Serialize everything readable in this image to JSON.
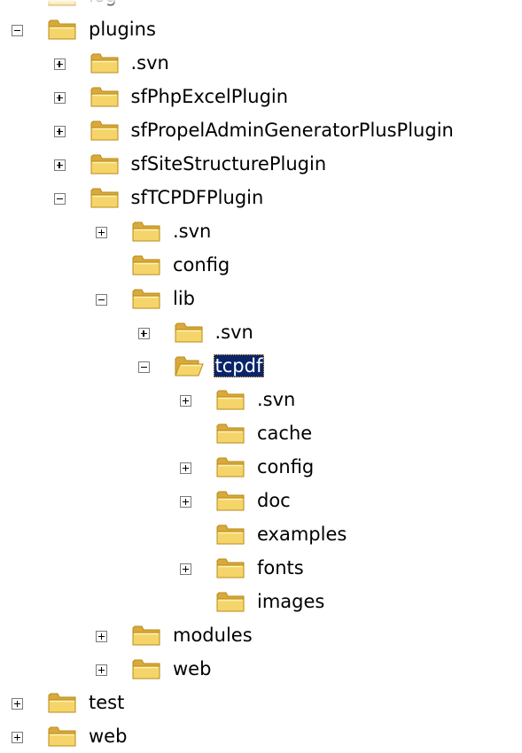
{
  "tree": {
    "nodes": [
      {
        "label": "log",
        "toggle": "none",
        "open": false,
        "depth": 0,
        "selected": false
      },
      {
        "label": "plugins",
        "toggle": "minus",
        "open": false,
        "depth": 0,
        "selected": false
      },
      {
        "label": ".svn",
        "toggle": "plus",
        "open": false,
        "depth": 1,
        "selected": false
      },
      {
        "label": "sfPhpExcelPlugin",
        "toggle": "plus",
        "open": false,
        "depth": 1,
        "selected": false
      },
      {
        "label": "sfPropelAdminGeneratorPlusPlugin",
        "toggle": "plus",
        "open": false,
        "depth": 1,
        "selected": false
      },
      {
        "label": "sfSiteStructurePlugin",
        "toggle": "plus",
        "open": false,
        "depth": 1,
        "selected": false
      },
      {
        "label": "sfTCPDFPlugin",
        "toggle": "minus",
        "open": false,
        "depth": 1,
        "selected": false
      },
      {
        "label": ".svn",
        "toggle": "plus",
        "open": false,
        "depth": 2,
        "selected": false
      },
      {
        "label": "config",
        "toggle": "none",
        "open": false,
        "depth": 2,
        "selected": false
      },
      {
        "label": "lib",
        "toggle": "minus",
        "open": false,
        "depth": 2,
        "selected": false
      },
      {
        "label": ".svn",
        "toggle": "plus",
        "open": false,
        "depth": 3,
        "selected": false
      },
      {
        "label": "tcpdf",
        "toggle": "minus",
        "open": true,
        "depth": 3,
        "selected": true
      },
      {
        "label": ".svn",
        "toggle": "plus",
        "open": false,
        "depth": 4,
        "selected": false
      },
      {
        "label": "cache",
        "toggle": "none",
        "open": false,
        "depth": 4,
        "selected": false
      },
      {
        "label": "config",
        "toggle": "plus",
        "open": false,
        "depth": 4,
        "selected": false
      },
      {
        "label": "doc",
        "toggle": "plus",
        "open": false,
        "depth": 4,
        "selected": false
      },
      {
        "label": "examples",
        "toggle": "none",
        "open": false,
        "depth": 4,
        "selected": false
      },
      {
        "label": "fonts",
        "toggle": "plus",
        "open": false,
        "depth": 4,
        "selected": false
      },
      {
        "label": "images",
        "toggle": "none",
        "open": false,
        "depth": 4,
        "selected": false
      },
      {
        "label": "modules",
        "toggle": "plus",
        "open": false,
        "depth": 2,
        "selected": false
      },
      {
        "label": "web",
        "toggle": "plus",
        "open": false,
        "depth": 2,
        "selected": false
      },
      {
        "label": "test",
        "toggle": "plus",
        "open": false,
        "depth": 0,
        "selected": false
      },
      {
        "label": "web",
        "toggle": "plus",
        "open": false,
        "depth": 0,
        "selected": false
      }
    ]
  },
  "colors": {
    "folder_fill": "#f5d56a",
    "folder_shade": "#d9a93b",
    "folder_outline": "#b98a1a",
    "selection_bg": "#0a246a",
    "selection_text": "#ffffff"
  }
}
